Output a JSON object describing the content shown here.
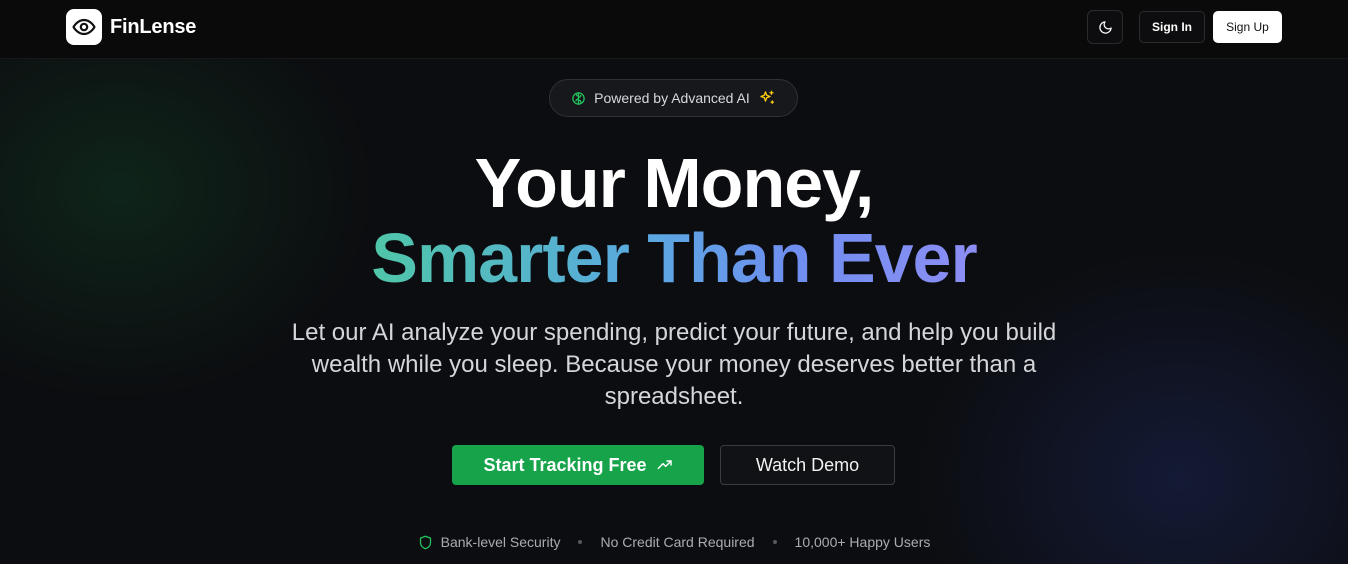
{
  "brand": {
    "name": "FinLense",
    "logo_icon": "eye-icon"
  },
  "nav": {
    "theme_toggle_icon": "moon-icon",
    "sign_in_label": "Sign In",
    "sign_up_label": "Sign Up"
  },
  "badge": {
    "text": "Powered by Advanced AI",
    "left_icon": "brain-icon",
    "right_icon": "sparkles-icon",
    "left_icon_color": "#22c55e",
    "right_icon_color": "#facc15"
  },
  "hero": {
    "headline_line1": "Your Money,",
    "headline_line2": "Smarter Than Ever",
    "subtitle": "Let our AI analyze your spending, predict your future, and help you build wealth while you sleep. Because your money deserves better than a spreadsheet."
  },
  "cta": {
    "primary_label": "Start Tracking Free",
    "primary_icon": "trending-up-icon",
    "primary_color": "#16a34a",
    "secondary_label": "Watch Demo"
  },
  "trust": {
    "items": [
      {
        "label": "Bank-level Security",
        "icon": "shield-icon",
        "icon_color": "#22c55e"
      },
      {
        "label": "No Credit Card Required"
      },
      {
        "label": "10,000+ Happy Users"
      }
    ]
  }
}
